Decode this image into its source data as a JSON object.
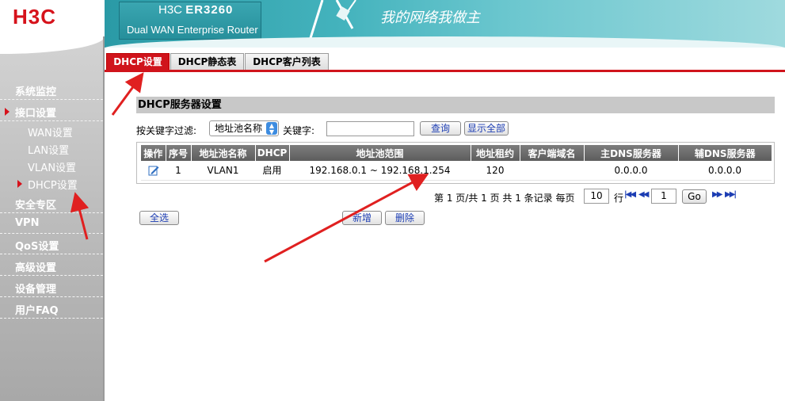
{
  "logo": "H3C",
  "banner": {
    "brand": "H3C",
    "model": "ER3260",
    "subtitle": "Dual WAN Enterprise Router",
    "slogan": "我的网络我做主"
  },
  "sidebar": {
    "items": [
      {
        "label": "系统监控"
      },
      {
        "label": "接口设置"
      },
      {
        "label": "安全专区"
      },
      {
        "label": "VPN"
      },
      {
        "label": "QoS设置"
      },
      {
        "label": "高级设置"
      },
      {
        "label": "设备管理"
      },
      {
        "label": "用户FAQ"
      }
    ],
    "subitems": [
      {
        "label": "WAN设置"
      },
      {
        "label": "LAN设置"
      },
      {
        "label": "VLAN设置"
      },
      {
        "label": "DHCP设置"
      }
    ]
  },
  "tabs": [
    {
      "label": "DHCP设置"
    },
    {
      "label": "DHCP静态表"
    },
    {
      "label": "DHCP客户列表"
    }
  ],
  "section": {
    "title": "DHCP服务器设置"
  },
  "filter": {
    "label": "按关键字过滤:",
    "selected": "地址池名称",
    "keyword_label": "关键字:",
    "keyword_value": "",
    "search": "查询",
    "show_all": "显示全部"
  },
  "table": {
    "headers": [
      "操作",
      "序号",
      "地址池名称",
      "DHCP",
      "地址池范围",
      "地址租约",
      "客户端域名",
      "主DNS服务器",
      "辅DNS服务器"
    ],
    "rows": [
      {
        "index": "1",
        "name": "VLAN1",
        "dhcp": "启用",
        "range": "192.168.0.1 ~ 192.168.1.254",
        "lease": "120",
        "domain": "",
        "dns1": "0.0.0.0",
        "dns2": "0.0.0.0"
      }
    ]
  },
  "pager": {
    "summary": "第 1 页/共 1 页 共 1 条记录 每页",
    "per_page": "10",
    "row_label": "行",
    "page": "1",
    "go": "Go"
  },
  "actions": {
    "select_all": "全选",
    "add": "新增",
    "delete": "删除"
  },
  "colors": {
    "accent_red": "#d0141c",
    "table_header": "#6b6b6b",
    "link_blue": "#1c3db3"
  }
}
